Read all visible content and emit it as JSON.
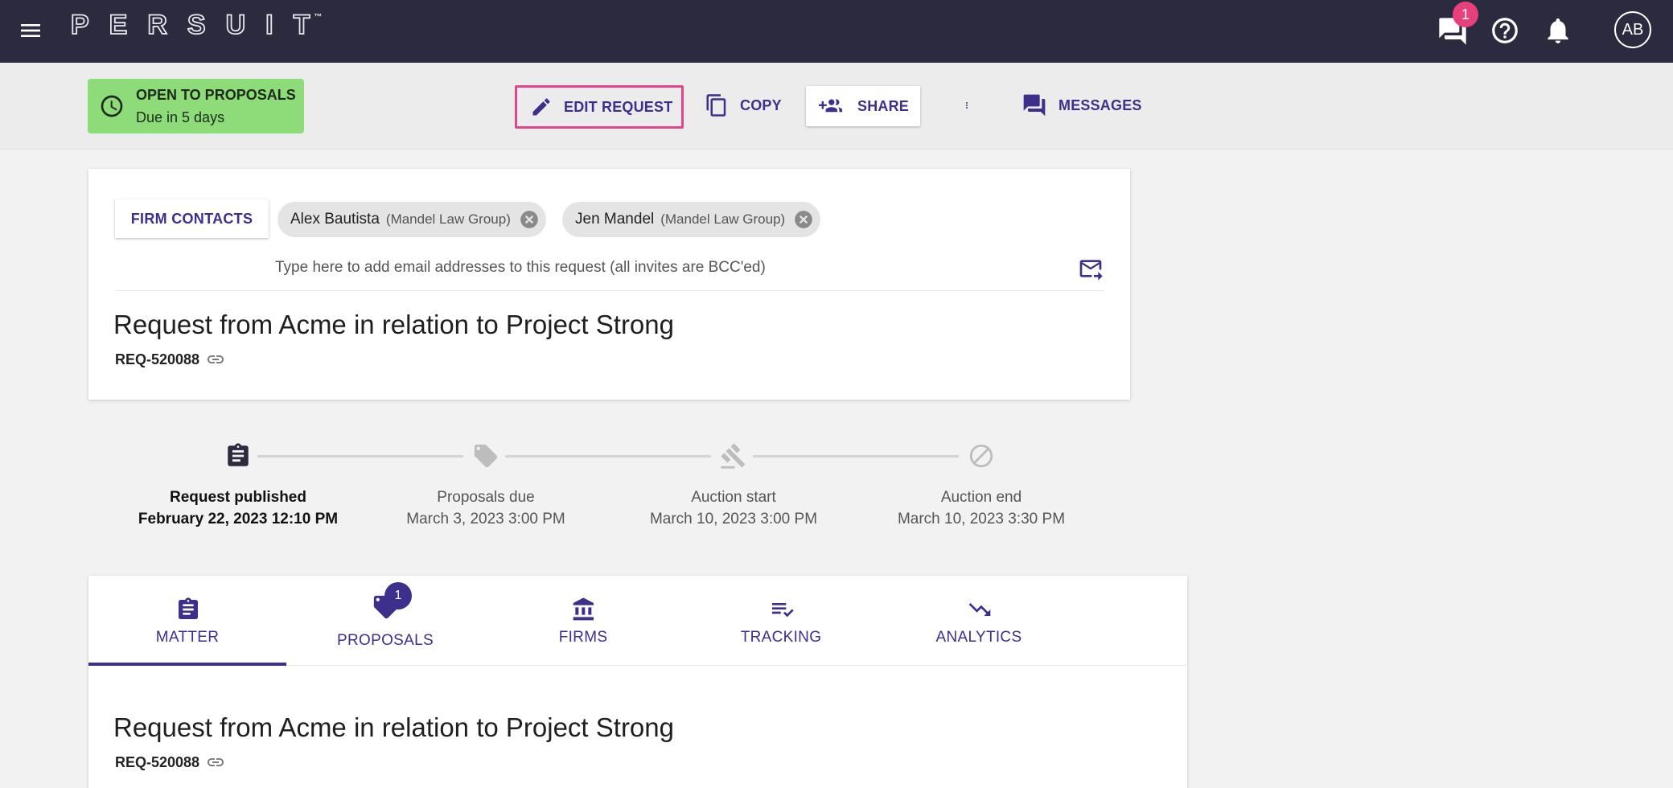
{
  "topbar": {
    "logo_text": "PERSUIT",
    "logo_tm": "™",
    "notification_count": "1",
    "avatar_initials": "AB",
    "icons": [
      "menu-icon",
      "chat-icon",
      "help-icon",
      "bell-icon"
    ]
  },
  "toolbar": {
    "status_title": "OPEN TO PROPOSALS",
    "status_due": "Due in 5 days",
    "status_color": "#8edc79",
    "edit_label": "EDIT REQUEST",
    "copy_label": "COPY",
    "share_label": "SHARE",
    "messages_label": "MESSAGES",
    "accent_color": "#3d2f8c",
    "highlight_color": "#e0468a"
  },
  "contacts": {
    "firm_contacts_label": "FIRM CONTACTS",
    "chips": [
      {
        "name": "Alex Bautista",
        "firm": "(Mandel Law Group)"
      },
      {
        "name": "Jen Mandel",
        "firm": "(Mandel Law Group)"
      }
    ],
    "email_placeholder": "Type here to add email addresses to this request (all invites are BCC'ed)"
  },
  "request": {
    "title": "Request from Acme in relation to Project Strong",
    "id": "REQ-520088"
  },
  "timeline": [
    {
      "label": "Request published",
      "date": "February 22, 2023 12:10 PM",
      "active": true,
      "icon": "clipboard-icon"
    },
    {
      "label": "Proposals due",
      "date": "March 3, 2023 3:00 PM",
      "active": false,
      "icon": "tag-icon"
    },
    {
      "label": "Auction start",
      "date": "March 10, 2023 3:00 PM",
      "active": false,
      "icon": "gavel-icon"
    },
    {
      "label": "Auction end",
      "date": "March 10, 2023 3:30 PM",
      "active": false,
      "icon": "blocked-icon"
    }
  ],
  "tabs": [
    {
      "label": "MATTER",
      "icon": "clipboard-icon",
      "active": true
    },
    {
      "label": "PROPOSALS",
      "icon": "tag-icon",
      "badge": "1"
    },
    {
      "label": "FIRMS",
      "icon": "bank-icon"
    },
    {
      "label": "TRACKING",
      "icon": "checklist-icon"
    },
    {
      "label": "ANALYTICS",
      "icon": "trending-down-icon"
    }
  ]
}
